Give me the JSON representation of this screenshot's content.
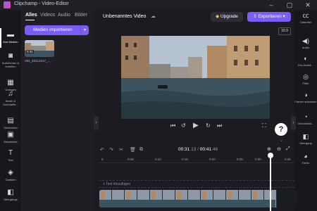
{
  "window": {
    "title": "Clipchamp - Video-Editor"
  },
  "leftnav": {
    "items": [
      {
        "label": "Ihre Medien",
        "icon": "folder-icon"
      },
      {
        "label": "Aufnehmen & erstellen",
        "icon": "camera-icon"
      },
      {
        "label": "Vorlagen",
        "icon": "template-icon"
      },
      {
        "label": "Musik & Soundeffe...",
        "icon": "music-icon"
      },
      {
        "label": "Stockvideo",
        "icon": "film-icon"
      },
      {
        "label": "Stockbilder",
        "icon": "image-icon"
      },
      {
        "label": "Text",
        "icon": "text-icon"
      },
      {
        "label": "Grafiken",
        "icon": "shapes-icon"
      },
      {
        "label": "Übergänge",
        "icon": "transition-icon"
      }
    ]
  },
  "panel": {
    "tabs": [
      "Alles",
      "Videos",
      "Audio",
      "Bilder"
    ],
    "import_label": "Medien importieren",
    "media": [
      {
        "name": "VID_20212217_...",
        "duration": "0:41"
      }
    ]
  },
  "header": {
    "project_name": "Unbenanntes Video",
    "upgrade_label": "Upgrade",
    "export_label": "Exportieren",
    "ratio": "16:9"
  },
  "player": {
    "help_label": "?"
  },
  "rightnav": {
    "items": [
      {
        "label": "Untertitel",
        "icon": "cc-icon"
      },
      {
        "label": "Audio",
        "icon": "speaker-icon"
      },
      {
        "label": "Ein-/Ausbl...",
        "icon": "fade-icon"
      },
      {
        "label": "Filter",
        "icon": "filter-icon"
      },
      {
        "label": "Farben anpassen",
        "icon": "palette-icon"
      },
      {
        "label": "Geschwind...",
        "icon": "speed-icon"
      },
      {
        "label": "Übergang",
        "icon": "transition-icon"
      },
      {
        "label": "Farbe",
        "icon": "color-icon"
      }
    ]
  },
  "timeline": {
    "current": "00:31",
    "current_frac": ".13",
    "separator": " / ",
    "total": "00:41",
    "total_frac": ".46",
    "ticks": [
      "0",
      "0:05",
      "0:10",
      "0:15",
      "0:20",
      "0:25",
      "0:30",
      "0:35"
    ],
    "add_text_label": "+ Text hinzufügen"
  }
}
